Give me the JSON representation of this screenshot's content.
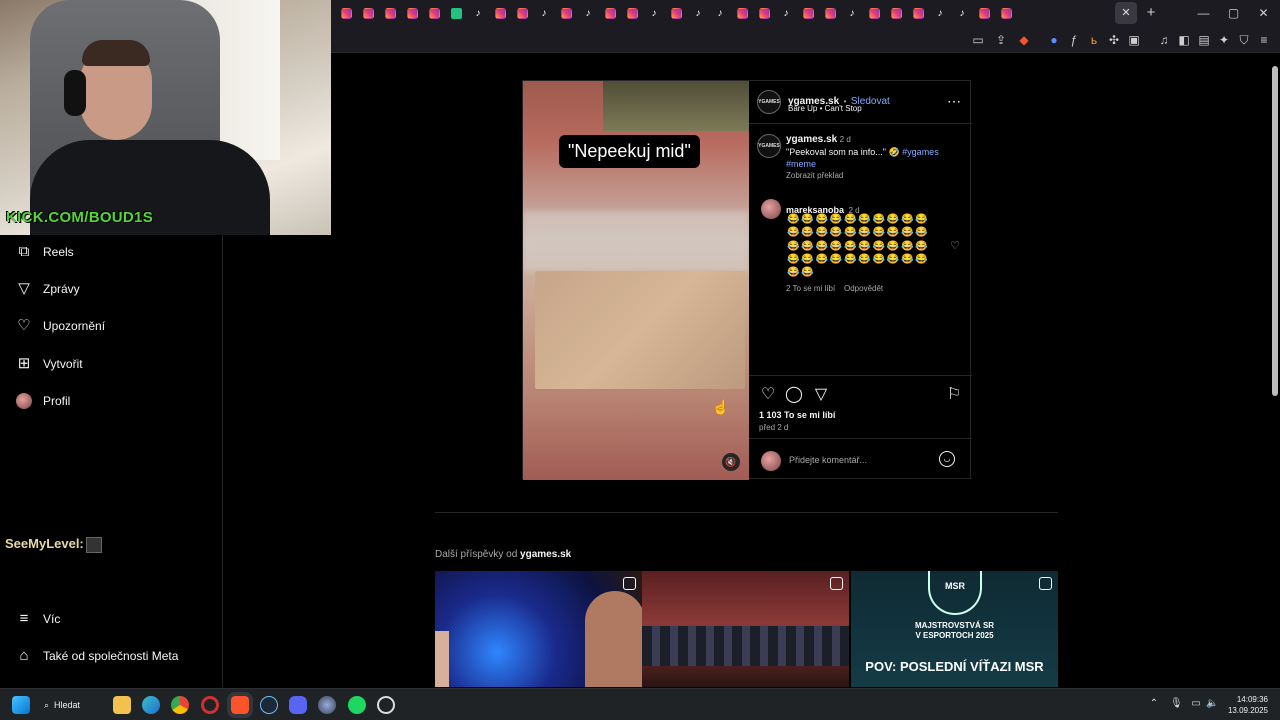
{
  "webcam": {
    "overlay": "KICK.COM/BOUD1S"
  },
  "tabs": {
    "favicons": [
      "ig",
      "ig",
      "ig",
      "ig",
      "ig",
      "green",
      "tt",
      "ig",
      "ig",
      "tt",
      "ig",
      "tt",
      "ig",
      "ig",
      "tt",
      "ig",
      "tt",
      "tt",
      "ig",
      "ig",
      "tt",
      "ig",
      "ig",
      "tt",
      "ig",
      "ig",
      "ig",
      "tt",
      "tt",
      "ig",
      "ig"
    ],
    "close": "✕",
    "new": "+"
  },
  "window_controls": {
    "minimize": "—",
    "maximize": "▢",
    "close": "✕"
  },
  "nav": {
    "items": [
      {
        "label": "Reels",
        "icon": "reels-icon"
      },
      {
        "label": "Zprávy",
        "icon": "send-icon"
      },
      {
        "label": "Upozornění",
        "icon": "heart-icon"
      },
      {
        "label": "Vytvořit",
        "icon": "plus-icon"
      },
      {
        "label": "Profil",
        "icon": "avatar"
      }
    ],
    "seemylevel": "SeeMyLevel:",
    "more": "Víc",
    "meta": "Také od společnosti Meta"
  },
  "post": {
    "caption_overlay": "\"Nepeekuj mid\"",
    "author": "ygames.sk",
    "dot": "•",
    "follow": "Sledovat",
    "audio": "Bare Up • Can't Stop",
    "avatar_text": "YGAMES",
    "desc": {
      "author": "ygames.sk",
      "age": "2 d",
      "text": "\"Peekoval som na info...\" 🤣",
      "hashtag1": "#ygames",
      "hashtag2": "#meme",
      "translate": "Zobrazit překlad"
    },
    "comment": {
      "author": "mareksanoba",
      "age": "2 d",
      "emojis": "😂😂😂😂😂😂😂😂😂😂😂😂😂😂😂😂😂😂😂😂😂😂😂😂😂😂😂😂😂😂😂😂😂😂😂😂😂😂😂😂😂😂",
      "likes": "2 To se mi líbí",
      "reply": "Odpovědět"
    },
    "likes": "1 103 To se mi líbí",
    "time": "před 2 d",
    "comment_placeholder": "Přidejte komentář..."
  },
  "more_posts": {
    "prefix": "Další příspěvky od",
    "author": "ygames.sk",
    "thumb3_logo": "MSR",
    "thumb3_title": "MAJSTROVSTVÁ SR\nV ESPORTOCH 2025",
    "thumb3_pov": "POV: POSLEDNÍ VÍŤAZI MSR"
  },
  "taskbar": {
    "search": "Hledat",
    "time": "14:09:36",
    "date": "13.09.2025"
  }
}
